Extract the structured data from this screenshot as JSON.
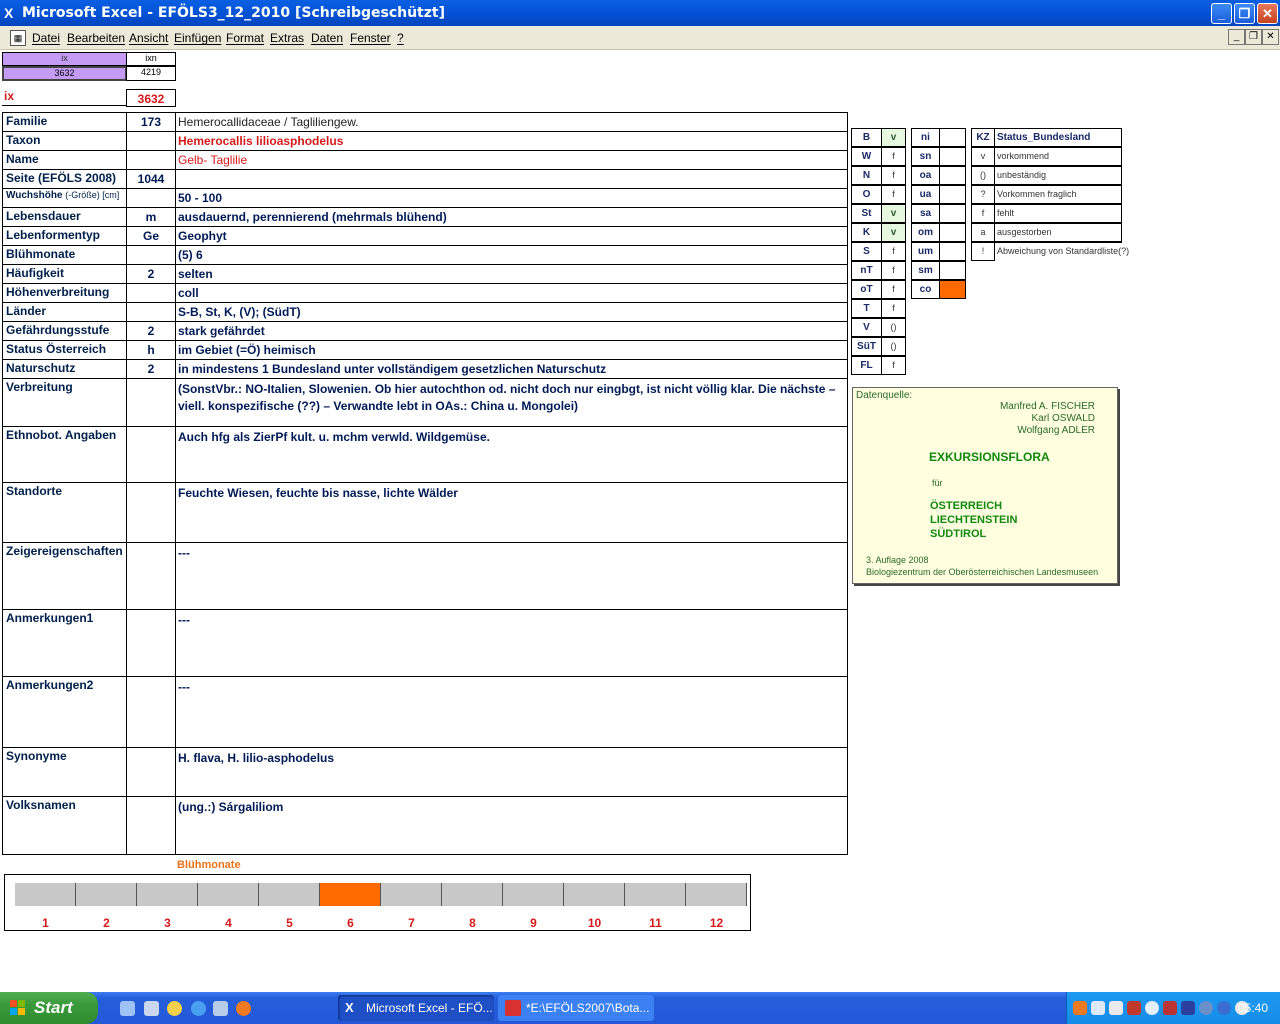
{
  "window": {
    "title": "Microsoft Excel - EFÖLS3_12_2010  [Schreibgeschützt]"
  },
  "menu": [
    "Datei",
    "Bearbeiten",
    "Ansicht",
    "Einfügen",
    "Format",
    "Extras",
    "Daten",
    "Fenster",
    "?"
  ],
  "top_cells": {
    "ix_head": "ix",
    "ixn_head": "ixn",
    "ix_val": "3632",
    "ixn_val": "4219",
    "ix_label": "ix",
    "ix_big": "3632"
  },
  "rows": [
    {
      "label": "Familie",
      "code": "173",
      "value": "Hemerocallidaceae  /  Tagliliengew."
    },
    {
      "label": "Taxon",
      "code": "",
      "value": "Hemerocallis lilioasphodelus"
    },
    {
      "label": "Name",
      "code": "",
      "value": "Gelb- Taglilie"
    },
    {
      "label": "Seite (EFÖLS 2008)",
      "code": "1044",
      "value": ""
    },
    {
      "label": "Wuchshöhe",
      "label_extra": "(-Größe) [cm]",
      "code": "",
      "value": " 50 - 100"
    },
    {
      "label": "Lebensdauer",
      "code": "m",
      "value": "ausdauernd, perennierend (mehrmals blühend)"
    },
    {
      "label": "Lebenformentyp",
      "code": "Ge",
      "value": "Geophyt"
    },
    {
      "label": "Blühmonate",
      "code": "",
      "value": "(5) 6"
    },
    {
      "label": "Häufigkeit",
      "code": "2",
      "value": "selten"
    },
    {
      "label": "Höhenverbreitung",
      "code": "",
      "value": "coll"
    },
    {
      "label": "Länder",
      "code": "",
      "value": "S-B, St, K, (V); (SüdT)"
    },
    {
      "label": "Gefährdungsstufe",
      "code": "2",
      "value": "stark gefährdet"
    },
    {
      "label": "Status Österreich",
      "code": "h",
      "value": "im Gebiet (=Ö) heimisch"
    },
    {
      "label": "Naturschutz",
      "code": "2",
      "value": "in mindestens 1 Bundesland unter vollständigem gesetzlichen Naturschutz"
    }
  ],
  "tall_rows": [
    {
      "label": "Verbreitung",
      "value": "(SonstVbr.: NO-Italien, Slowenien. Ob hier autochthon od. nicht doch nur eingbgt, ist nicht völlig klar. Die nächste – viell. konspezifische (??) – Verwandte lebt in OAs.: China u. Mongolei)"
    },
    {
      "label": "Ethnobot. Angaben",
      "value": "Auch hfg als ZierPf kult. u. mchm verwld. Wildgemüse."
    },
    {
      "label": "Standorte",
      "value": "Feuchte Wiesen, feuchte bis nasse, lichte Wälder"
    },
    {
      "label": "Zeigereigenschaften",
      "value": "---"
    },
    {
      "label": "Anmerkungen1",
      "value": "---"
    },
    {
      "label": "Anmerkungen2",
      "value": "---"
    },
    {
      "label": "Synonyme",
      "value": "H. flava, H. lilio-asphodelus"
    },
    {
      "label": "Volksnamen",
      "value": "(ung.:) Sárgaliliom"
    }
  ],
  "laender": [
    {
      "code": "B",
      "val": "v",
      "green": true
    },
    {
      "code": "W",
      "val": "f",
      "green": false
    },
    {
      "code": "N",
      "val": "f",
      "green": false
    },
    {
      "code": "O",
      "val": "f",
      "green": false
    },
    {
      "code": "St",
      "val": "v",
      "green": true
    },
    {
      "code": "K",
      "val": "v",
      "green": true
    },
    {
      "code": "S",
      "val": "f",
      "green": false
    },
    {
      "code": "nT",
      "val": "f",
      "green": false
    },
    {
      "code": "oT",
      "val": "f",
      "green": false
    },
    {
      "code": "T",
      "val": "f",
      "green": false
    },
    {
      "code": "V",
      "val": "()",
      "green": false
    },
    {
      "code": "SüT",
      "val": "()",
      "green": false
    },
    {
      "code": "FL",
      "val": "f",
      "green": false
    }
  ],
  "hoehen": [
    {
      "code": "ni",
      "orange": false
    },
    {
      "code": "sn",
      "orange": false
    },
    {
      "code": "oa",
      "orange": false
    },
    {
      "code": "ua",
      "orange": false
    },
    {
      "code": "sa",
      "orange": false
    },
    {
      "code": "om",
      "orange": false
    },
    {
      "code": "um",
      "orange": false
    },
    {
      "code": "sm",
      "orange": false
    },
    {
      "code": "co",
      "orange": true
    }
  ],
  "status_legend": {
    "head_kz": "KZ",
    "head_status": "Status_Bundesland",
    "items": [
      {
        "kz": "v",
        "text": "vorkommend"
      },
      {
        "kz": "()",
        "text": "unbeständig"
      },
      {
        "kz": "?",
        "text": "Vorkommen fraglich"
      },
      {
        "kz": "f",
        "text": "fehlt"
      },
      {
        "kz": "a",
        "text": "ausgestorben"
      },
      {
        "kz": "!",
        "text": "Abweichung von Standardliste(?)"
      }
    ]
  },
  "datenquelle": {
    "label": "Datenquelle:",
    "authors": [
      "Manfred A. FISCHER",
      "Karl OSWALD",
      "Wolfgang ADLER"
    ],
    "book": "EXKURSIONSFLORA",
    "fuer": "für",
    "countries": [
      "ÖSTERREICH",
      "LIECHTENSTEIN",
      "SÜDTIROL"
    ],
    "edition": "3. Auflage 2008",
    "publisher": "Biologiezentrum der Oberösterreichischen Landesmuseen"
  },
  "bluehmonate": {
    "title": "Blühmonate",
    "months": [
      "1",
      "2",
      "3",
      "4",
      "5",
      "6",
      "7",
      "8",
      "9",
      "10",
      "11",
      "12"
    ],
    "active": [
      false,
      false,
      false,
      false,
      false,
      true,
      false,
      false,
      false,
      false,
      false,
      false
    ]
  },
  "taskbar": {
    "start": "Start",
    "tasks": [
      "Microsoft Excel - EFÖ...",
      "*E:\\EFÖLS2007\\Bota..."
    ],
    "clock": "05:40"
  },
  "colors": {
    "accent_purple": "#c59cf5",
    "green_cell": "#e6f8e0",
    "orange": "#ff6a00",
    "label_red": "#d51a1a"
  }
}
